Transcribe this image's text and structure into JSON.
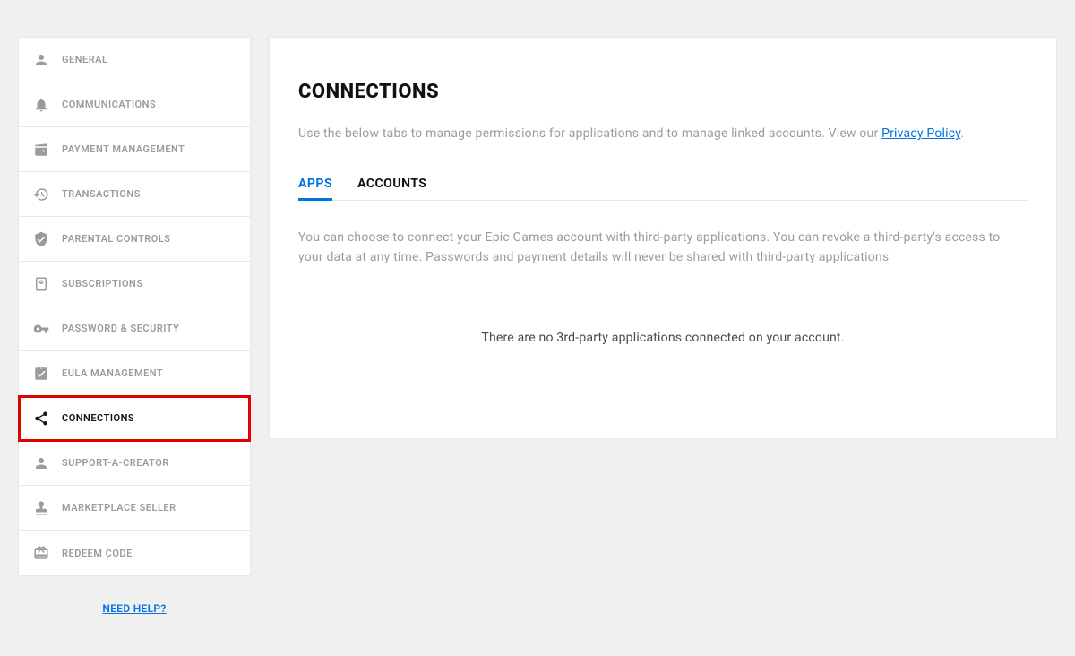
{
  "sidebar": {
    "items": [
      {
        "label": "GENERAL",
        "icon": "person-icon"
      },
      {
        "label": "COMMUNICATIONS",
        "icon": "bell-icon"
      },
      {
        "label": "PAYMENT MANAGEMENT",
        "icon": "wallet-icon"
      },
      {
        "label": "TRANSACTIONS",
        "icon": "history-icon"
      },
      {
        "label": "PARENTAL CONTROLS",
        "icon": "shield-check-icon"
      },
      {
        "label": "SUBSCRIPTIONS",
        "icon": "receipt-icon"
      },
      {
        "label": "PASSWORD & SECURITY",
        "icon": "key-icon"
      },
      {
        "label": "EULA MANAGEMENT",
        "icon": "clipboard-check-icon"
      },
      {
        "label": "CONNECTIONS",
        "icon": "share-icon"
      },
      {
        "label": "SUPPORT-A-CREATOR",
        "icon": "person-solid-icon"
      },
      {
        "label": "MARKETPLACE SELLER",
        "icon": "stamp-icon"
      },
      {
        "label": "REDEEM CODE",
        "icon": "gift-icon"
      }
    ],
    "need_help": "NEED HELP?"
  },
  "main": {
    "title": "CONNECTIONS",
    "desc_prefix": "Use the below tabs to manage permissions for applications and to manage linked accounts. View our ",
    "privacy_link": "Privacy Policy",
    "desc_suffix": ".",
    "tabs": [
      {
        "label": "APPS"
      },
      {
        "label": "ACCOUNTS"
      }
    ],
    "tab_desc": "You can choose to connect your Epic Games account with third-party applications. You can revoke a third-party's access to your data at any time. Passwords and payment details will never be shared with third-party applications",
    "empty": "There are no 3rd-party applications connected on your account."
  }
}
